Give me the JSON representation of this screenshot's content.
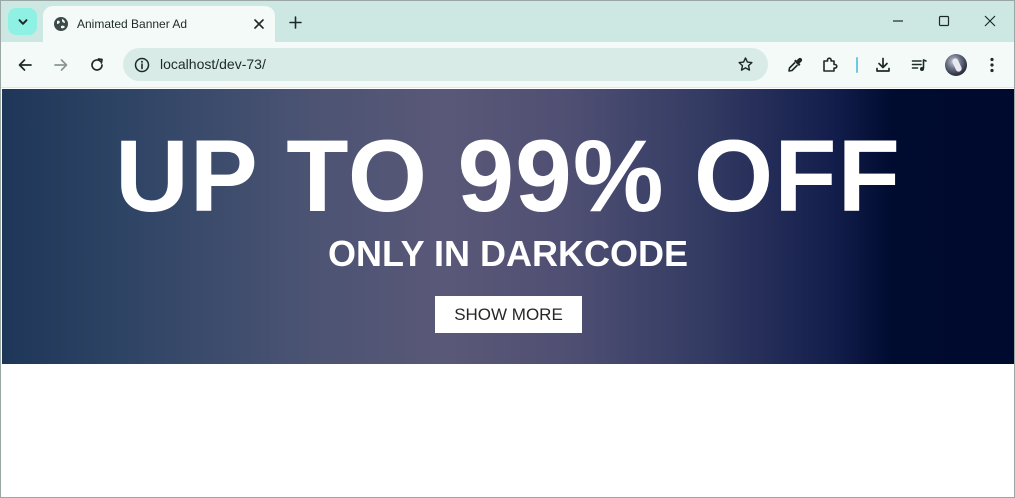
{
  "browser": {
    "tab": {
      "title": "Animated Banner Ad",
      "favicon": "globe-icon"
    },
    "address_bar": {
      "url": "localhost/dev-73/"
    },
    "icons": {
      "tab_search": "chevron-down-icon",
      "close_tab": "close-icon",
      "new_tab": "plus-icon",
      "minimize": "minimize-icon",
      "maximize": "maximize-icon",
      "close_window": "close-icon",
      "back": "arrow-left-icon",
      "forward": "arrow-right-icon",
      "reload": "reload-icon",
      "site_info": "info-icon",
      "bookmark": "star-icon",
      "eyedropper": "eyedropper-icon",
      "extensions": "puzzle-icon",
      "downloads": "download-icon",
      "media": "playlist-icon",
      "profile": "avatar",
      "menu": "kebab-menu-icon"
    }
  },
  "banner": {
    "headline": "UP TO 99% OFF",
    "subline": "ONLY IN DARKCODE",
    "button_label": "SHOW MORE"
  },
  "colors": {
    "tabstrip": "#cde8e2",
    "toolbar": "#f3faf8",
    "omnibox": "#d8ebe6",
    "tab_search_bg": "#8ff1e3",
    "banner_left": "#1e3658",
    "banner_center": "#5a5878",
    "banner_right": "#000a2e",
    "banner_text": "#ffffff",
    "button_bg": "#ffffff",
    "button_text": "#262626"
  }
}
